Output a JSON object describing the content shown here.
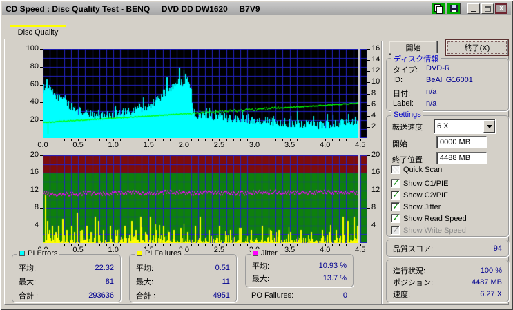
{
  "window": {
    "title": "CD Speed : Disc Quality Test - BENQ     DVD DD DW1620     B7V9",
    "close_glyph": "X"
  },
  "tab": {
    "label": "Disc Quality"
  },
  "buttons": {
    "start": "開始",
    "exit": "終了(X)"
  },
  "disc_info": {
    "title": "ディスク情報",
    "rows": [
      {
        "label": "タイプ:",
        "value": "DVD-R"
      },
      {
        "label": "ID:",
        "value": "BeAll G16001"
      },
      {
        "label": "日付:",
        "value": "n/a"
      },
      {
        "label": "Label:",
        "value": "n/a"
      }
    ]
  },
  "settings": {
    "title": "Settings",
    "speed_label": "転送速度",
    "speed_value": "6 X",
    "start_label": "開始",
    "start_value": "0000 MB",
    "end_label": "終了位置",
    "end_value": "4488 MB",
    "checkboxes": [
      {
        "label": "Quick Scan",
        "checked": false,
        "disabled": false
      },
      {
        "label": "Show C1/PIE",
        "checked": true,
        "disabled": false
      },
      {
        "label": "Show C2/PIF",
        "checked": true,
        "disabled": false
      },
      {
        "label": "Show Jitter",
        "checked": true,
        "disabled": false
      },
      {
        "label": "Show Read Speed",
        "checked": true,
        "disabled": false
      },
      {
        "label": "Show Write Speed",
        "checked": true,
        "disabled": true
      }
    ]
  },
  "quality": {
    "label": "品質スコア:",
    "value": "94"
  },
  "progress": {
    "rows": [
      {
        "label": "進行状況:",
        "value": "100 %"
      },
      {
        "label": "ポジション:",
        "value": "4487 MB"
      },
      {
        "label": "速度:",
        "value": "6.27 X"
      }
    ]
  },
  "stats": {
    "pi_errors": {
      "title": "PI Errors",
      "color": "#00ffff",
      "rows": [
        {
          "label": "平均:",
          "value": "22.32"
        },
        {
          "label": "最大:",
          "value": "81"
        },
        {
          "label": "合計 :",
          "value": "293636"
        }
      ]
    },
    "pi_failures": {
      "title": "PI Failures",
      "color": "#ffff00",
      "rows": [
        {
          "label": "平均:",
          "value": "0.51"
        },
        {
          "label": "最大:",
          "value": "11"
        },
        {
          "label": "合計 :",
          "value": "4951"
        }
      ]
    },
    "jitter": {
      "title": "Jitter",
      "color": "#ff00ff",
      "rows": [
        {
          "label": "平均:",
          "value": "10.93 %"
        },
        {
          "label": "最大:",
          "value": "13.7 %"
        }
      ]
    },
    "po_failures": {
      "label": "PO Failures:",
      "value": "0"
    }
  },
  "chart_data": [
    {
      "type": "area",
      "name": "PI Errors (cyan area, left axis 0-100) with Read Speed (green line, right axis 0-16X)",
      "x_max": 4.6,
      "x_ticks": [
        0.0,
        0.5,
        1.0,
        1.5,
        2.0,
        2.5,
        3.0,
        3.5,
        4.0,
        4.5
      ],
      "x_minor_step": 0.1,
      "position_x": 4.487,
      "bg": "#000000",
      "grid_color": "#2323c8",
      "position_line_color": "#dcdcdc",
      "left_axis": {
        "range": [
          0,
          100
        ],
        "ticks": [
          20,
          40,
          60,
          80,
          100
        ],
        "grid_step": 10
      },
      "right_axis": {
        "range": [
          0,
          16
        ],
        "ticks": [
          2,
          4,
          6,
          8,
          10,
          12,
          14,
          16
        ]
      },
      "series": [
        {
          "name": "PI Errors",
          "axis": "left",
          "style": "area",
          "color": "#00ffff",
          "noise": 5,
          "spike_chance": 0.06,
          "spike_amp": 11,
          "points": [
            [
              0,
              55
            ],
            [
              0.04,
              62
            ],
            [
              0.08,
              56
            ],
            [
              0.12,
              52
            ],
            [
              0.16,
              50
            ],
            [
              0.22,
              46
            ],
            [
              0.27,
              44
            ],
            [
              0.3,
              49
            ],
            [
              0.34,
              40
            ],
            [
              0.4,
              35
            ],
            [
              0.45,
              33
            ],
            [
              0.5,
              31
            ],
            [
              0.6,
              28
            ],
            [
              0.7,
              27
            ],
            [
              0.8,
              27
            ],
            [
              0.9,
              26
            ],
            [
              1.0,
              27
            ],
            [
              1.1,
              28
            ],
            [
              1.2,
              29
            ],
            [
              1.3,
              31
            ],
            [
              1.35,
              38
            ],
            [
              1.4,
              34
            ],
            [
              1.5,
              36
            ],
            [
              1.6,
              42
            ],
            [
              1.7,
              50
            ],
            [
              1.8,
              55
            ],
            [
              1.85,
              58
            ],
            [
              1.9,
              62
            ],
            [
              1.95,
              64
            ],
            [
              2.0,
              60
            ],
            [
              2.05,
              63
            ],
            [
              2.1,
              57
            ],
            [
              2.13,
              28
            ],
            [
              2.2,
              26
            ],
            [
              2.3,
              27
            ],
            [
              2.45,
              25
            ],
            [
              2.6,
              23
            ],
            [
              2.75,
              22
            ],
            [
              2.9,
              21
            ],
            [
              3.05,
              20
            ],
            [
              3.2,
              19
            ],
            [
              3.35,
              18
            ],
            [
              3.5,
              17
            ],
            [
              3.7,
              16
            ],
            [
              3.9,
              15
            ],
            [
              4.05,
              16
            ],
            [
              4.2,
              17
            ],
            [
              4.35,
              18
            ],
            [
              4.487,
              18
            ]
          ],
          "peaks": [
            [
              0.05,
              66
            ],
            [
              1.75,
              68
            ],
            [
              1.93,
              79
            ],
            [
              2.02,
              72
            ],
            [
              4.42,
              24
            ]
          ]
        },
        {
          "name": "Read Speed",
          "axis": "right",
          "style": "line",
          "color": "#00ff00",
          "thick": 1.6,
          "noise": 0.07,
          "noise_zones": [
            {
              "from": 2.1,
              "to": 3.35,
              "amp": 0.22
            }
          ],
          "points": [
            [
              0,
              2.8
            ],
            [
              4.487,
              6.27
            ]
          ],
          "dips": [
            [
              0.07,
              0.8
            ]
          ]
        }
      ]
    },
    {
      "type": "bars",
      "name": "PI Failures (yellow bars) with Jitter (magenta line), axis 0-20",
      "x_max": 4.6,
      "x_ticks": [
        0.0,
        0.5,
        1.0,
        1.5,
        2.0,
        2.5,
        3.0,
        3.5,
        4.0,
        4.5
      ],
      "x_minor_step": 0.1,
      "position_x": 4.487,
      "grid_color": "#2323c8",
      "position_line_color": "#dcdcdc",
      "bg_zones": [
        {
          "from": 0,
          "to": 16,
          "color": "#0d800d"
        },
        {
          "from": 16,
          "to": 20,
          "color": "#7c0c0c"
        }
      ],
      "left_axis": {
        "range": [
          0,
          20
        ],
        "ticks": [
          4,
          8,
          12,
          16,
          20
        ],
        "grid_step": 2
      },
      "right_axis": {
        "range": [
          0,
          20
        ],
        "ticks": [
          4,
          8,
          12,
          16,
          20
        ]
      },
      "series": [
        {
          "name": "PI Failures",
          "axis": "left",
          "style": "bars",
          "color": "#ffff00",
          "baseline": 1.4,
          "spikes": [
            [
              0.03,
              11
            ],
            [
              0.055,
              5
            ],
            [
              0.09,
              3
            ],
            [
              0.13,
              4
            ],
            [
              0.18,
              2.5
            ],
            [
              0.22,
              4
            ],
            [
              0.27,
              5.5
            ],
            [
              0.33,
              3
            ],
            [
              0.4,
              4
            ],
            [
              0.44,
              2.5
            ],
            [
              0.48,
              7
            ],
            [
              0.55,
              3
            ],
            [
              0.62,
              4
            ],
            [
              0.68,
              2.5
            ],
            [
              0.73,
              6
            ],
            [
              0.78,
              5
            ],
            [
              0.85,
              3
            ],
            [
              0.95,
              4
            ],
            [
              1.05,
              3
            ],
            [
              1.15,
              4
            ],
            [
              1.25,
              5
            ],
            [
              1.31,
              3
            ],
            [
              1.38,
              6
            ],
            [
              1.45,
              2.5
            ],
            [
              1.52,
              6
            ],
            [
              1.6,
              3
            ],
            [
              1.7,
              4
            ],
            [
              1.78,
              2.5
            ],
            [
              1.85,
              3
            ],
            [
              1.95,
              3.5
            ],
            [
              2.05,
              2.5
            ],
            [
              2.15,
              4
            ],
            [
              2.22,
              6
            ],
            [
              2.35,
              3
            ],
            [
              2.5,
              4
            ],
            [
              2.65,
              3
            ],
            [
              2.8,
              3.5
            ],
            [
              2.95,
              3
            ],
            [
              3.1,
              4
            ],
            [
              3.22,
              3
            ],
            [
              3.35,
              3
            ],
            [
              3.5,
              2.5
            ],
            [
              3.65,
              3
            ],
            [
              3.8,
              2.5
            ],
            [
              3.95,
              3
            ],
            [
              4.05,
              2.5
            ],
            [
              4.15,
              3
            ],
            [
              4.25,
              6
            ],
            [
              4.32,
              5
            ],
            [
              4.4,
              6
            ],
            [
              4.45,
              4
            ]
          ]
        },
        {
          "name": "Jitter",
          "axis": "left",
          "style": "line",
          "color": "#ff00ff",
          "thick": 2,
          "noise": 0.45,
          "points": [
            [
              0,
              11.3
            ],
            [
              0.3,
              11.1
            ],
            [
              0.6,
              11.4
            ],
            [
              0.9,
              11.2
            ],
            [
              1.2,
              11.5
            ],
            [
              1.5,
              11.3
            ],
            [
              1.8,
              11.6
            ],
            [
              2.1,
              11.4
            ],
            [
              2.4,
              11.5
            ],
            [
              2.7,
              11.3
            ],
            [
              3.0,
              11.5
            ],
            [
              3.3,
              11.6
            ],
            [
              3.6,
              11.4
            ],
            [
              3.9,
              11.6
            ],
            [
              4.2,
              11.5
            ],
            [
              4.487,
              11.4
            ]
          ]
        }
      ]
    }
  ]
}
